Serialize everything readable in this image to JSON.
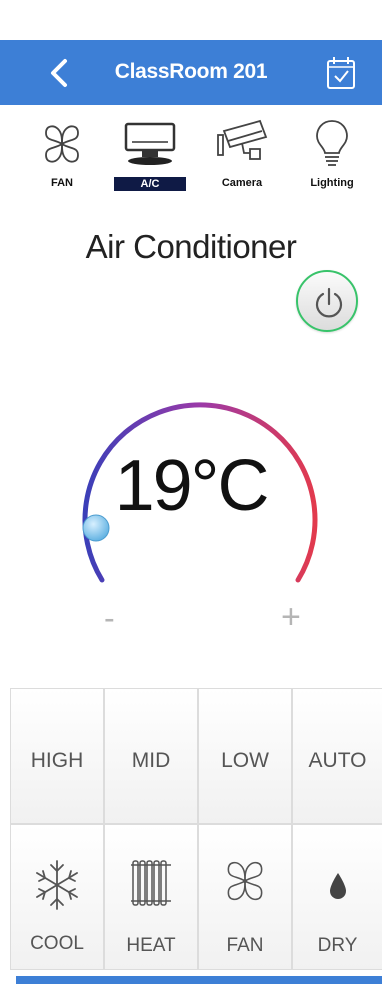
{
  "header": {
    "title": "ClassRoom 201",
    "back_icon": "back-chevron-icon",
    "right_icon": "calendar-check-icon"
  },
  "device_tabs": [
    {
      "label": "FAN",
      "icon": "fan-icon",
      "active": false
    },
    {
      "label": "A/C",
      "icon": "monitor-ac-icon",
      "active": true
    },
    {
      "label": "Camera",
      "icon": "camera-icon",
      "active": false
    },
    {
      "label": "Lighting",
      "icon": "lightbulb-icon",
      "active": false
    }
  ],
  "main": {
    "title": "Air Conditioner",
    "temperature": "19°C",
    "minus_label": "-",
    "plus_label": "+",
    "power_icon": "power-icon"
  },
  "fan_speed": [
    "HIGH",
    "MID",
    "LOW",
    "AUTO"
  ],
  "modes": [
    {
      "label": "COOL",
      "icon": "snowflake-icon"
    },
    {
      "label": "HEAT",
      "icon": "heater-icon"
    },
    {
      "label": "FAN",
      "icon": "fan-icon"
    },
    {
      "label": "DRY",
      "icon": "droplet-icon"
    }
  ],
  "colors": {
    "header_blue": "#3d7fd6",
    "arc_cold": "#3b3fb8",
    "arc_mid": "#9b3aa8",
    "arc_hot": "#e23a4d",
    "power_ring": "#38c36a",
    "active_tab": "#0f1a45"
  }
}
